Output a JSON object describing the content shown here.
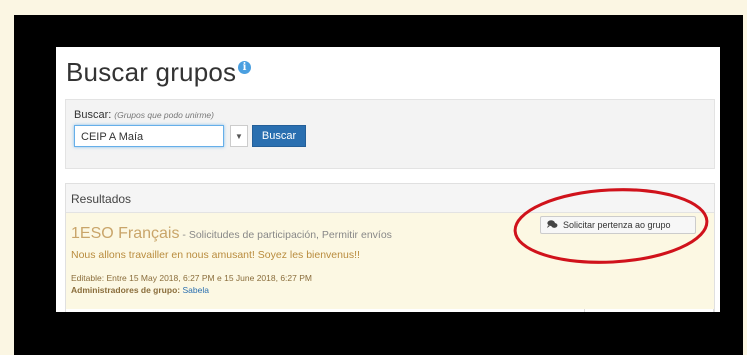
{
  "page": {
    "title": "Buscar grupos"
  },
  "search": {
    "label": "Buscar:",
    "hint": "(Grupos que podo unirme)",
    "value": "CEIP A Maía",
    "button_label": "Buscar"
  },
  "results": {
    "header": "Resultados",
    "items": [
      {
        "name": "1ESO Français",
        "meta": " - Solicitudes de participación, Permitir envíos",
        "description": "Nous allons travailler en nous amusant! Soyez les bienvenus!!",
        "editable": "Editable: Entre 15 May 2018, 6:27 PM e 15 June 2018, 6:27 PM",
        "admins_label": "Administradores de grupo:",
        "admin_name": "Sabela",
        "join_label": "Solicitar pertenza ao grupo"
      }
    ]
  },
  "colors": {
    "accent": "#2a6fb0",
    "highlight_row": "#fcf8e3",
    "annotation": "#d0121b"
  },
  "icons": {
    "info": "info-icon",
    "chat": "chat-icon",
    "dropdown": "chevron-down-icon"
  }
}
